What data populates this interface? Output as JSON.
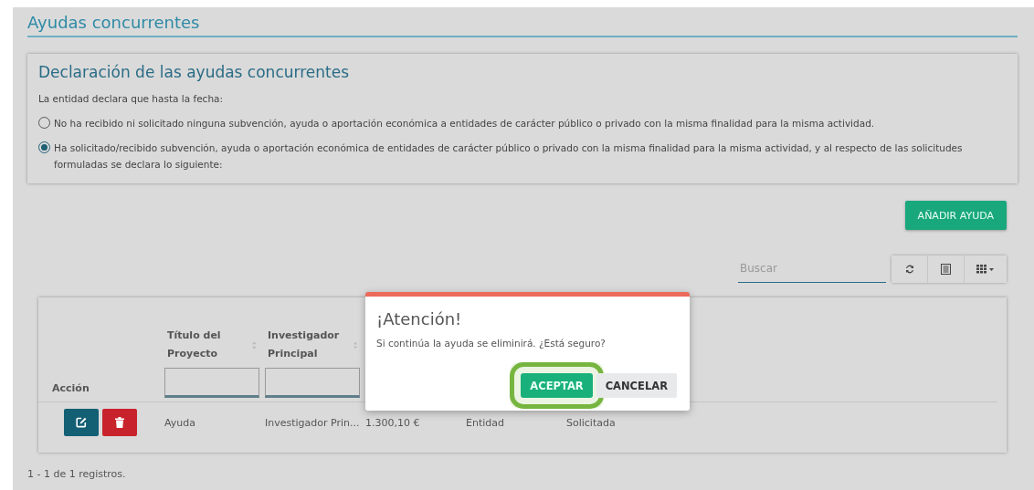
{
  "page_title": "Ayudas concurrentes",
  "declaration": {
    "title": "Declaración de las ayudas concurrentes",
    "intro": "La entidad declara que hasta la fecha:",
    "options": [
      {
        "label": "No ha recibido ni solicitado ninguna subvención, ayuda o aportación económica a entidades de carácter público o privado con la misma finalidad para la misma actividad.",
        "selected": false
      },
      {
        "label": "Ha solicitado/recibido subvención, ayuda o aportación económica de entidades de carácter público o privado con la misma finalidad para la misma actividad, y al respecto de las solicitudes formuladas se declara lo siguiente:",
        "selected": true
      }
    ]
  },
  "add_button": "AÑADIR AYUDA",
  "search": {
    "placeholder": "Buscar"
  },
  "table": {
    "columns": [
      "Acción",
      "Título del Proyecto",
      "Investigador Principal"
    ],
    "rows": [
      {
        "cells": [
          "",
          "Ayuda",
          "Investigador Prin...",
          "1.300,10 €",
          "Entidad",
          "Solicitada"
        ]
      }
    ]
  },
  "footer": "1 - 1 de 1 registros.",
  "dialog": {
    "title": "¡Atención!",
    "message": "Si continúa la ayuda se eliminirá. ¿Está seguro?",
    "buttons": [
      {
        "label": "ACEPTAR",
        "kind": "primary",
        "highlighted": true
      },
      {
        "label": "CANCELAR",
        "kind": "secondary",
        "highlighted": false
      }
    ]
  }
}
